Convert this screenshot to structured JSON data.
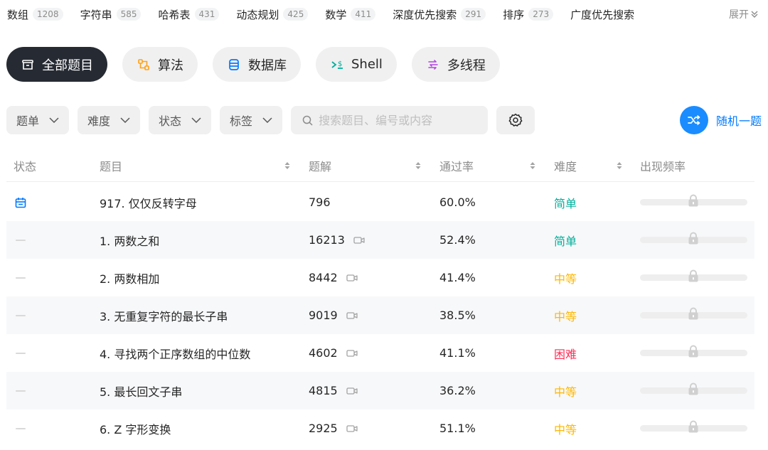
{
  "tags": [
    {
      "label": "数组",
      "count": "1208"
    },
    {
      "label": "字符串",
      "count": "585"
    },
    {
      "label": "哈希表",
      "count": "431"
    },
    {
      "label": "动态规划",
      "count": "425"
    },
    {
      "label": "数学",
      "count": "411"
    },
    {
      "label": "深度优先搜索",
      "count": "291"
    },
    {
      "label": "排序",
      "count": "273"
    },
    {
      "label": "广度优先搜索",
      "count": ""
    }
  ],
  "expand_label": "展开",
  "categories": [
    {
      "label": "全部题目",
      "icon": "list-box-icon",
      "active": true
    },
    {
      "label": "算法",
      "icon": "algorithm-icon",
      "color": "#ffa116"
    },
    {
      "label": "数据库",
      "icon": "database-icon",
      "color": "#007aff"
    },
    {
      "label": "Shell",
      "icon": "terminal-icon",
      "color": "#00af9b"
    },
    {
      "label": "多线程",
      "icon": "threads-icon",
      "color": "#b146e0"
    }
  ],
  "filters": {
    "list_label": "题单",
    "difficulty_label": "难度",
    "status_label": "状态",
    "tags_label": "标签",
    "search_placeholder": "搜索题目、编号或内容",
    "random_label": "随机一题"
  },
  "columns": {
    "status": "状态",
    "title": "题目",
    "solutions": "题解",
    "acceptance": "通过率",
    "difficulty": "难度",
    "frequency": "出现频率"
  },
  "colors": {
    "easy": "#00af9b",
    "medium": "#ffb800",
    "hard": "#ff2d55",
    "accent": "#007aff"
  },
  "rows": [
    {
      "status": "calendar-icon",
      "title": "917. 仅仅反转字母",
      "solutions": "796",
      "video": false,
      "acceptance": "60.0%",
      "difficulty": "简单",
      "level": "easy"
    },
    {
      "status": "none",
      "title": "1. 两数之和",
      "solutions": "16213",
      "video": true,
      "acceptance": "52.4%",
      "difficulty": "简单",
      "level": "easy"
    },
    {
      "status": "none",
      "title": "2. 两数相加",
      "solutions": "8442",
      "video": true,
      "acceptance": "41.4%",
      "difficulty": "中等",
      "level": "medium"
    },
    {
      "status": "none",
      "title": "3. 无重复字符的最长子串",
      "solutions": "9019",
      "video": true,
      "acceptance": "38.5%",
      "difficulty": "中等",
      "level": "medium"
    },
    {
      "status": "none",
      "title": "4. 寻找两个正序数组的中位数",
      "solutions": "4602",
      "video": true,
      "acceptance": "41.1%",
      "difficulty": "困难",
      "level": "hard"
    },
    {
      "status": "none",
      "title": "5. 最长回文子串",
      "solutions": "4815",
      "video": true,
      "acceptance": "36.2%",
      "difficulty": "中等",
      "level": "medium"
    },
    {
      "status": "none",
      "title": "6. Z 字形变换",
      "solutions": "2925",
      "video": true,
      "acceptance": "51.1%",
      "difficulty": "中等",
      "level": "medium"
    }
  ]
}
